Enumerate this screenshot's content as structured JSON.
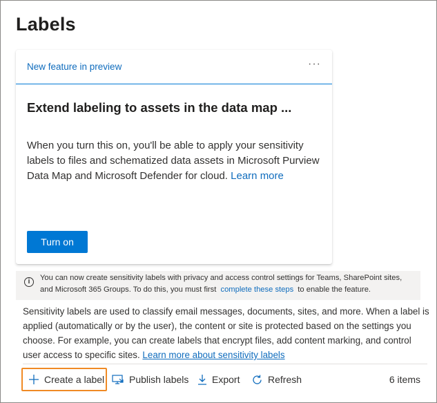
{
  "page": {
    "title": "Labels"
  },
  "feature_card": {
    "eyebrow": "New feature in preview",
    "more": "···",
    "heading": "Extend labeling to assets in the data map ...",
    "body": "When you turn this on, you'll be able to apply your sensitivity labels to files and schematized data assets in Microsoft Purview Data Map and Microsoft Defender for cloud.",
    "learn_more": "Learn more",
    "button_label": "Turn on"
  },
  "info_bar": {
    "icon": "info-icon",
    "text_before": "You can now create sensitivity labels with privacy and access control settings for Teams, SharePoint sites, and Microsoft 365 Groups. To do this, you must first",
    "link": "complete these steps",
    "text_after": "to enable the feature."
  },
  "description": {
    "text": "Sensitivity labels are used to classify email messages, documents, sites, and more. When a label is applied (automatically or by the user), the content or site is protected based on the settings you choose. For example, you can create labels that encrypt files, add content marking, and control user access to specific sites.",
    "link": "Learn more about sensitivity labels"
  },
  "toolbar": {
    "create": "Create a label",
    "publish": "Publish labels",
    "export": "Export",
    "refresh": "Refresh",
    "count": "6 items"
  },
  "colors": {
    "accent": "#0078d4",
    "link": "#0f6cbd",
    "highlight": "#f08a24",
    "info_bg": "#f3f2f1"
  }
}
